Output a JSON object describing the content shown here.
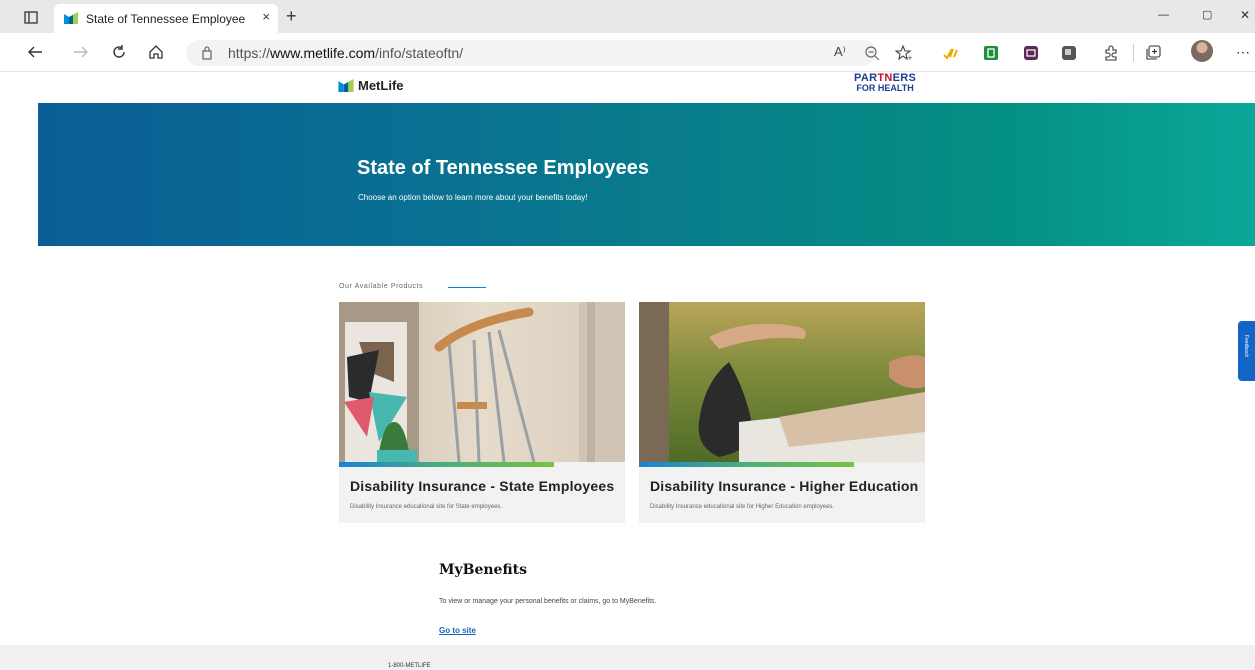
{
  "browser": {
    "tab": {
      "title": "State of Tennessee Employee Ber",
      "close": "×"
    },
    "new_tab": "+",
    "window_controls": {
      "minimize": "—",
      "restore": "▢",
      "close": "✕"
    },
    "address": {
      "url_prefix": "https://",
      "url_domain": "www.metlife.com",
      "url_path": "/info/stateoftn/"
    },
    "icons": [
      "tab-actions-icon",
      "back-icon",
      "forward-icon",
      "refresh-icon",
      "home-icon",
      "site-info-icon",
      "read-aloud-icon",
      "zoom-icon",
      "favorite-icon",
      "extension-icons",
      "collections-icon",
      "profile-avatar",
      "more-icon"
    ],
    "read_aloud": "A⁾"
  },
  "site": {
    "logo_text": "MetLife",
    "partner_logo": {
      "line1_a": "PAR",
      "line1_b": "TN",
      "line1_c": "ERS",
      "line2": "FOR HEALTH"
    },
    "colors": {
      "hero_start": "#0a5e95",
      "hero_end": "#0aa89a",
      "link": "#1565c0",
      "feedback": "#1366c7"
    }
  },
  "hero": {
    "title": "State of Tennessee Employees",
    "subtitle": "Choose an option below to learn more about your benefits today!"
  },
  "products": {
    "section_label": "Our Available Products",
    "cards": [
      {
        "title": "Disability Insurance - State Employees",
        "description": "Disability Insurance educational site for State employees."
      },
      {
        "title": "Disability Insurance - Higher Education",
        "description": "Disability Insurance educational site for Higher Education employees."
      }
    ]
  },
  "mybenefits": {
    "title": "MyBenefits",
    "description": "To view or manage your personal benefits or claims, go to MyBenefits.",
    "link": "Go to site"
  },
  "footer": {
    "text": "1-800-METLIFE"
  },
  "feedback": {
    "label": "Feedback"
  }
}
